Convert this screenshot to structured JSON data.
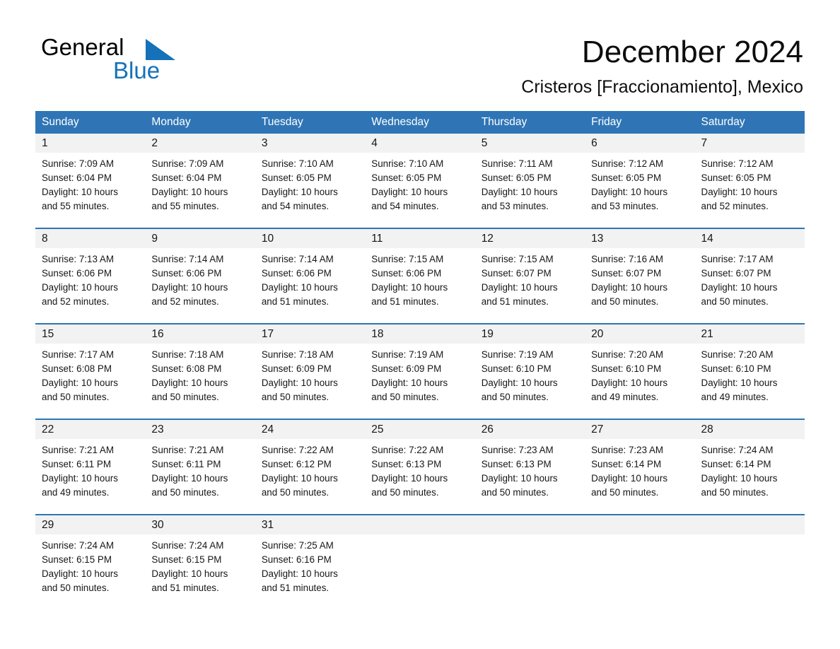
{
  "brand": {
    "name_part1": "General",
    "name_part2": "Blue",
    "accent_color": "#1572b8"
  },
  "header": {
    "title": "December 2024",
    "subtitle": "Cristeros [Fraccionamiento], Mexico"
  },
  "theme": {
    "header_blue": "#2f75b5",
    "daynum_band": "#f2f2f2",
    "text": "#161616"
  },
  "weekdays": [
    "Sunday",
    "Monday",
    "Tuesday",
    "Wednesday",
    "Thursday",
    "Friday",
    "Saturday"
  ],
  "weeks": [
    {
      "days": [
        {
          "num": "1",
          "sunrise": "Sunrise: 7:09 AM",
          "sunset": "Sunset: 6:04 PM",
          "daylight_l1": "Daylight: 10 hours",
          "daylight_l2": "and 55 minutes."
        },
        {
          "num": "2",
          "sunrise": "Sunrise: 7:09 AM",
          "sunset": "Sunset: 6:04 PM",
          "daylight_l1": "Daylight: 10 hours",
          "daylight_l2": "and 55 minutes."
        },
        {
          "num": "3",
          "sunrise": "Sunrise: 7:10 AM",
          "sunset": "Sunset: 6:05 PM",
          "daylight_l1": "Daylight: 10 hours",
          "daylight_l2": "and 54 minutes."
        },
        {
          "num": "4",
          "sunrise": "Sunrise: 7:10 AM",
          "sunset": "Sunset: 6:05 PM",
          "daylight_l1": "Daylight: 10 hours",
          "daylight_l2": "and 54 minutes."
        },
        {
          "num": "5",
          "sunrise": "Sunrise: 7:11 AM",
          "sunset": "Sunset: 6:05 PM",
          "daylight_l1": "Daylight: 10 hours",
          "daylight_l2": "and 53 minutes."
        },
        {
          "num": "6",
          "sunrise": "Sunrise: 7:12 AM",
          "sunset": "Sunset: 6:05 PM",
          "daylight_l1": "Daylight: 10 hours",
          "daylight_l2": "and 53 minutes."
        },
        {
          "num": "7",
          "sunrise": "Sunrise: 7:12 AM",
          "sunset": "Sunset: 6:05 PM",
          "daylight_l1": "Daylight: 10 hours",
          "daylight_l2": "and 52 minutes."
        }
      ]
    },
    {
      "days": [
        {
          "num": "8",
          "sunrise": "Sunrise: 7:13 AM",
          "sunset": "Sunset: 6:06 PM",
          "daylight_l1": "Daylight: 10 hours",
          "daylight_l2": "and 52 minutes."
        },
        {
          "num": "9",
          "sunrise": "Sunrise: 7:14 AM",
          "sunset": "Sunset: 6:06 PM",
          "daylight_l1": "Daylight: 10 hours",
          "daylight_l2": "and 52 minutes."
        },
        {
          "num": "10",
          "sunrise": "Sunrise: 7:14 AM",
          "sunset": "Sunset: 6:06 PM",
          "daylight_l1": "Daylight: 10 hours",
          "daylight_l2": "and 51 minutes."
        },
        {
          "num": "11",
          "sunrise": "Sunrise: 7:15 AM",
          "sunset": "Sunset: 6:06 PM",
          "daylight_l1": "Daylight: 10 hours",
          "daylight_l2": "and 51 minutes."
        },
        {
          "num": "12",
          "sunrise": "Sunrise: 7:15 AM",
          "sunset": "Sunset: 6:07 PM",
          "daylight_l1": "Daylight: 10 hours",
          "daylight_l2": "and 51 minutes."
        },
        {
          "num": "13",
          "sunrise": "Sunrise: 7:16 AM",
          "sunset": "Sunset: 6:07 PM",
          "daylight_l1": "Daylight: 10 hours",
          "daylight_l2": "and 50 minutes."
        },
        {
          "num": "14",
          "sunrise": "Sunrise: 7:17 AM",
          "sunset": "Sunset: 6:07 PM",
          "daylight_l1": "Daylight: 10 hours",
          "daylight_l2": "and 50 minutes."
        }
      ]
    },
    {
      "days": [
        {
          "num": "15",
          "sunrise": "Sunrise: 7:17 AM",
          "sunset": "Sunset: 6:08 PM",
          "daylight_l1": "Daylight: 10 hours",
          "daylight_l2": "and 50 minutes."
        },
        {
          "num": "16",
          "sunrise": "Sunrise: 7:18 AM",
          "sunset": "Sunset: 6:08 PM",
          "daylight_l1": "Daylight: 10 hours",
          "daylight_l2": "and 50 minutes."
        },
        {
          "num": "17",
          "sunrise": "Sunrise: 7:18 AM",
          "sunset": "Sunset: 6:09 PM",
          "daylight_l1": "Daylight: 10 hours",
          "daylight_l2": "and 50 minutes."
        },
        {
          "num": "18",
          "sunrise": "Sunrise: 7:19 AM",
          "sunset": "Sunset: 6:09 PM",
          "daylight_l1": "Daylight: 10 hours",
          "daylight_l2": "and 50 minutes."
        },
        {
          "num": "19",
          "sunrise": "Sunrise: 7:19 AM",
          "sunset": "Sunset: 6:10 PM",
          "daylight_l1": "Daylight: 10 hours",
          "daylight_l2": "and 50 minutes."
        },
        {
          "num": "20",
          "sunrise": "Sunrise: 7:20 AM",
          "sunset": "Sunset: 6:10 PM",
          "daylight_l1": "Daylight: 10 hours",
          "daylight_l2": "and 49 minutes."
        },
        {
          "num": "21",
          "sunrise": "Sunrise: 7:20 AM",
          "sunset": "Sunset: 6:10 PM",
          "daylight_l1": "Daylight: 10 hours",
          "daylight_l2": "and 49 minutes."
        }
      ]
    },
    {
      "days": [
        {
          "num": "22",
          "sunrise": "Sunrise: 7:21 AM",
          "sunset": "Sunset: 6:11 PM",
          "daylight_l1": "Daylight: 10 hours",
          "daylight_l2": "and 49 minutes."
        },
        {
          "num": "23",
          "sunrise": "Sunrise: 7:21 AM",
          "sunset": "Sunset: 6:11 PM",
          "daylight_l1": "Daylight: 10 hours",
          "daylight_l2": "and 50 minutes."
        },
        {
          "num": "24",
          "sunrise": "Sunrise: 7:22 AM",
          "sunset": "Sunset: 6:12 PM",
          "daylight_l1": "Daylight: 10 hours",
          "daylight_l2": "and 50 minutes."
        },
        {
          "num": "25",
          "sunrise": "Sunrise: 7:22 AM",
          "sunset": "Sunset: 6:13 PM",
          "daylight_l1": "Daylight: 10 hours",
          "daylight_l2": "and 50 minutes."
        },
        {
          "num": "26",
          "sunrise": "Sunrise: 7:23 AM",
          "sunset": "Sunset: 6:13 PM",
          "daylight_l1": "Daylight: 10 hours",
          "daylight_l2": "and 50 minutes."
        },
        {
          "num": "27",
          "sunrise": "Sunrise: 7:23 AM",
          "sunset": "Sunset: 6:14 PM",
          "daylight_l1": "Daylight: 10 hours",
          "daylight_l2": "and 50 minutes."
        },
        {
          "num": "28",
          "sunrise": "Sunrise: 7:24 AM",
          "sunset": "Sunset: 6:14 PM",
          "daylight_l1": "Daylight: 10 hours",
          "daylight_l2": "and 50 minutes."
        }
      ]
    },
    {
      "days": [
        {
          "num": "29",
          "sunrise": "Sunrise: 7:24 AM",
          "sunset": "Sunset: 6:15 PM",
          "daylight_l1": "Daylight: 10 hours",
          "daylight_l2": "and 50 minutes."
        },
        {
          "num": "30",
          "sunrise": "Sunrise: 7:24 AM",
          "sunset": "Sunset: 6:15 PM",
          "daylight_l1": "Daylight: 10 hours",
          "daylight_l2": "and 51 minutes."
        },
        {
          "num": "31",
          "sunrise": "Sunrise: 7:25 AM",
          "sunset": "Sunset: 6:16 PM",
          "daylight_l1": "Daylight: 10 hours",
          "daylight_l2": "and 51 minutes."
        },
        {
          "num": "",
          "sunrise": "",
          "sunset": "",
          "daylight_l1": "",
          "daylight_l2": ""
        },
        {
          "num": "",
          "sunrise": "",
          "sunset": "",
          "daylight_l1": "",
          "daylight_l2": ""
        },
        {
          "num": "",
          "sunrise": "",
          "sunset": "",
          "daylight_l1": "",
          "daylight_l2": ""
        },
        {
          "num": "",
          "sunrise": "",
          "sunset": "",
          "daylight_l1": "",
          "daylight_l2": ""
        }
      ]
    }
  ]
}
